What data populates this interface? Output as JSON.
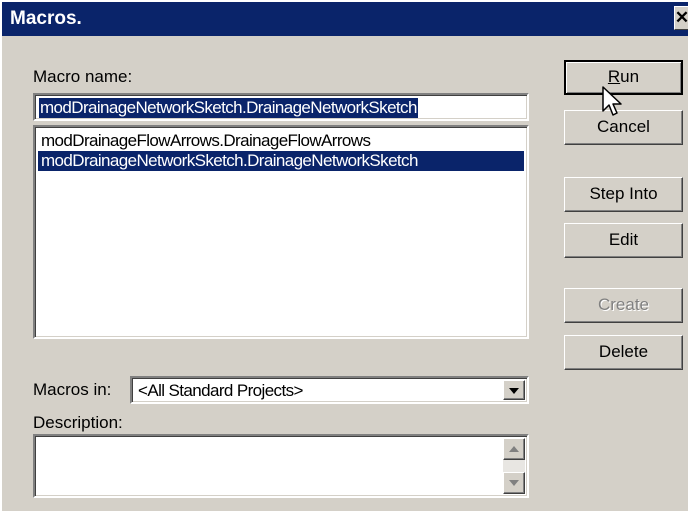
{
  "window": {
    "title": "Macros.",
    "close_glyph": "✕"
  },
  "macro_name": {
    "label": "Macro name:",
    "value": "modDrainageNetworkSketch.DrainageNetworkSketch"
  },
  "macro_list": {
    "items": [
      {
        "label": "modDrainageFlowArrows.DrainageFlowArrows",
        "selected": false
      },
      {
        "label": "modDrainageNetworkSketch.DrainageNetworkSketch",
        "selected": true
      }
    ]
  },
  "buttons": {
    "run": {
      "label_access": "R",
      "label_rest": "un",
      "default": true,
      "enabled": true
    },
    "cancel": {
      "label": "Cancel",
      "enabled": true
    },
    "step_into": {
      "label": "Step Into",
      "enabled": true
    },
    "edit": {
      "label": "Edit",
      "enabled": true
    },
    "create": {
      "label": "Create",
      "enabled": false
    },
    "delete": {
      "label": "Delete",
      "enabled": true
    }
  },
  "macros_in": {
    "label": "Macros in:",
    "value": "<All Standard Projects>"
  },
  "description": {
    "label": "Description:",
    "value": ""
  },
  "colors": {
    "titlebar": "#0a246a",
    "selection": "#0a246a",
    "face": "#d4d0c8"
  },
  "icons": {
    "close": "close-icon",
    "dropdown": "chevron-down-icon",
    "scroll_up": "scroll-up-arrow-icon",
    "scroll_down": "scroll-down-arrow-icon",
    "cursor": "mouse-pointer-icon"
  }
}
